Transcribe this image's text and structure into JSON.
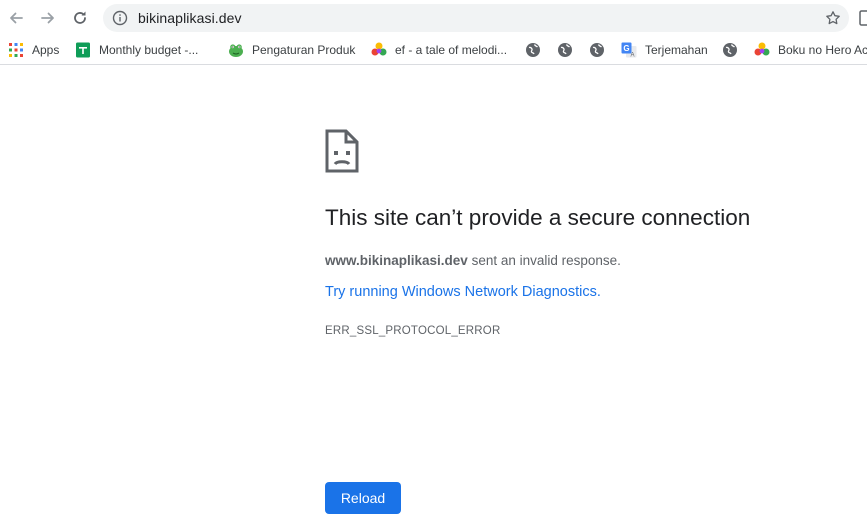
{
  "toolbar": {
    "url": "bikinaplikasi.dev",
    "back_icon": "back-arrow-icon",
    "forward_icon": "forward-arrow-icon",
    "reload_icon": "reload-icon",
    "info_icon": "info-icon",
    "star_icon": "star-icon"
  },
  "bookmarks": [
    {
      "label": "Apps",
      "icon": "apps-grid-icon"
    },
    {
      "label": "Monthly budget -...",
      "icon": "sheets-icon"
    },
    {
      "label": "Pengaturan Produk",
      "icon": "frog-icon"
    },
    {
      "label": "ef - a tale of melodi...",
      "icon": "colorful-leaf-icon"
    },
    {
      "label": "",
      "icon": "globe-icon"
    },
    {
      "label": "",
      "icon": "globe-icon"
    },
    {
      "label": "",
      "icon": "globe-icon"
    },
    {
      "label": "Terjemahan",
      "icon": "translate-icon"
    },
    {
      "label": "",
      "icon": "globe-icon"
    },
    {
      "label": "Boku no Hero Ac",
      "icon": "colorful-leaf-icon"
    }
  ],
  "error": {
    "title": "This site can’t provide a secure connection",
    "host": "www.bikinaplikasi.dev",
    "message_suffix": " sent an invalid response.",
    "diagnostics_link": "Try running Windows Network Diagnostics.",
    "code": "ERR_SSL_PROTOCOL_ERROR",
    "reload_label": "Reload"
  },
  "colors": {
    "accent": "#1a73e8",
    "omnibox_bg": "#f1f3f4",
    "text_primary": "#202124",
    "text_secondary": "#5f6368"
  }
}
